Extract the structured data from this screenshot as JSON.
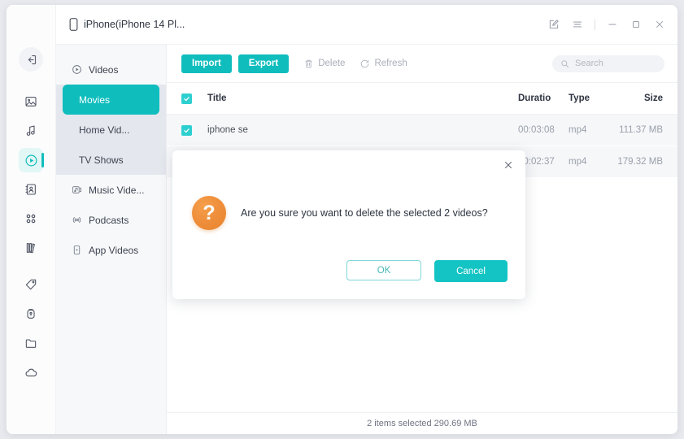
{
  "colors": {
    "accent": "#0fbdbd",
    "accent_light": "#2ecfd0",
    "modal_icon": "#ef8f3c",
    "nav_group_bg": "#e4e7ed",
    "row_bg": "#f6f7f9"
  },
  "titlebar": {
    "device_label": "iPhone(iPhone 14 Pl...",
    "device_icon": "phone-icon",
    "buttons": [
      {
        "name": "feedback-icon",
        "label": ""
      },
      {
        "name": "menu-icon",
        "label": ""
      },
      {
        "name": "minimize-icon",
        "label": ""
      },
      {
        "name": "maximize-icon",
        "label": ""
      },
      {
        "name": "close-icon",
        "label": ""
      }
    ]
  },
  "rail": {
    "back_icon": "back-arrow-icon",
    "items": [
      {
        "icon": "photos-icon",
        "active": false
      },
      {
        "icon": "music-icon",
        "active": false
      },
      {
        "icon": "videos-icon",
        "active": true
      },
      {
        "icon": "contacts-icon",
        "active": false
      },
      {
        "icon": "apps-icon",
        "active": false
      },
      {
        "icon": "books-icon",
        "active": false
      },
      {
        "icon": "tag-icon",
        "active": false
      },
      {
        "icon": "safe-icon",
        "active": false
      },
      {
        "icon": "folder-icon",
        "active": false
      },
      {
        "icon": "cloud-icon",
        "active": false
      }
    ]
  },
  "nav": {
    "items": [
      {
        "label": "Videos",
        "icon": "videos-icon",
        "sub": false,
        "selected": false
      },
      {
        "label": "Movies",
        "icon": "",
        "sub": true,
        "selected": true
      },
      {
        "label": "Home Vid...",
        "icon": "",
        "sub": true,
        "selected": false
      },
      {
        "label": "TV Shows",
        "icon": "",
        "sub": true,
        "selected": false
      },
      {
        "label": "Music Vide...",
        "icon": "music-video-icon",
        "sub": false,
        "selected": false
      },
      {
        "label": "Podcasts",
        "icon": "podcast-icon",
        "sub": false,
        "selected": false
      },
      {
        "label": "App Videos",
        "icon": "app-video-icon",
        "sub": false,
        "selected": false
      }
    ]
  },
  "toolbar": {
    "import_label": "Import",
    "export_label": "Export",
    "delete_label": "Delete",
    "refresh_label": "Refresh",
    "search_placeholder": "Search",
    "search_value": ""
  },
  "table": {
    "headers": {
      "title": "Title",
      "duration": "Duratio",
      "type": "Type",
      "size": "Size"
    },
    "select_all_checked": true,
    "rows": [
      {
        "checked": true,
        "title": "iphone se",
        "duration": "00:03:08",
        "type": "mp4",
        "size": "111.37 MB"
      },
      {
        "checked": true,
        "title": "",
        "duration": "00:02:37",
        "type": "mp4",
        "size": "179.32 MB"
      }
    ]
  },
  "status": {
    "text": "2 items selected 290.69 MB"
  },
  "modal": {
    "icon": "question-icon",
    "icon_glyph": "?",
    "message": "Are you sure you want to delete the selected 2 videos?",
    "ok_label": "OK",
    "cancel_label": "Cancel",
    "close_icon": "close-icon"
  }
}
